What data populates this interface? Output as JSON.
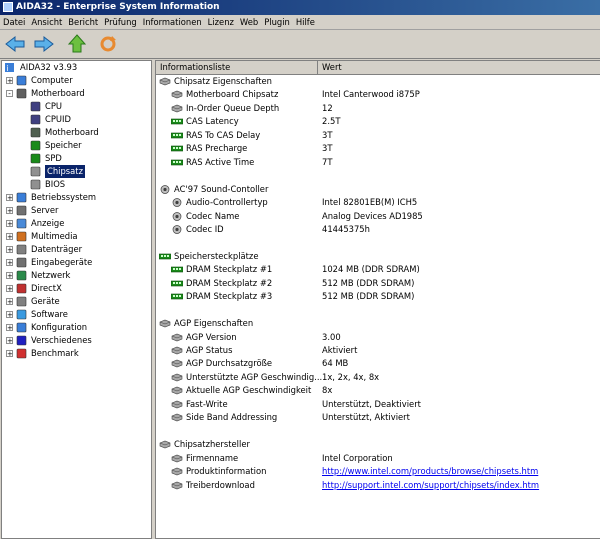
{
  "window": {
    "title": "AIDA32 - Enterprise System Information"
  },
  "menu": [
    "Datei",
    "Ansicht",
    "Bericht",
    "Prüfung",
    "Informationen",
    "Lizenz",
    "Web",
    "Plugin",
    "Hilfe"
  ],
  "toolbar": {
    "buttons": [
      "back-arrow-icon",
      "forward-arrow-icon",
      "up-arrow-icon",
      "refresh-icon"
    ]
  },
  "tree": {
    "root": "AIDA32 v3.93",
    "items": [
      {
        "label": "Computer",
        "level": 1,
        "expander": "+"
      },
      {
        "label": "Motherboard",
        "level": 1,
        "expander": "-"
      },
      {
        "label": "CPU",
        "level": 2
      },
      {
        "label": "CPUID",
        "level": 2
      },
      {
        "label": "Motherboard",
        "level": 2
      },
      {
        "label": "Speicher",
        "level": 2
      },
      {
        "label": "SPD",
        "level": 2
      },
      {
        "label": "Chipsatz",
        "level": 2,
        "selected": true
      },
      {
        "label": "BIOS",
        "level": 2
      },
      {
        "label": "Betriebssystem",
        "level": 1,
        "expander": "+"
      },
      {
        "label": "Server",
        "level": 1,
        "expander": "+"
      },
      {
        "label": "Anzeige",
        "level": 1,
        "expander": "+"
      },
      {
        "label": "Multimedia",
        "level": 1,
        "expander": "+"
      },
      {
        "label": "Datenträger",
        "level": 1,
        "expander": "+"
      },
      {
        "label": "Eingabegeräte",
        "level": 1,
        "expander": "+"
      },
      {
        "label": "Netzwerk",
        "level": 1,
        "expander": "+"
      },
      {
        "label": "DirectX",
        "level": 1,
        "expander": "+"
      },
      {
        "label": "Geräte",
        "level": 1,
        "expander": "+"
      },
      {
        "label": "Software",
        "level": 1,
        "expander": "+"
      },
      {
        "label": "Konfiguration",
        "level": 1,
        "expander": "+"
      },
      {
        "label": "Verschiedenes",
        "level": 1,
        "expander": "+"
      },
      {
        "label": "Benchmark",
        "level": 1,
        "expander": "+"
      }
    ]
  },
  "list": {
    "col_field": "Informationsliste",
    "col_value": "Wert",
    "rows": [
      {
        "type": "group",
        "label": "Chipsatz Eigenschaften"
      },
      {
        "type": "item",
        "label": "Motherboard Chipsatz",
        "value": "Intel Canterwood i875P",
        "icon": "chip"
      },
      {
        "type": "item",
        "label": "In-Order Queue Depth",
        "value": "12",
        "icon": "chip"
      },
      {
        "type": "item",
        "label": "CAS Latency",
        "value": "2.5T",
        "icon": "ram"
      },
      {
        "type": "item",
        "label": "RAS To CAS Delay",
        "value": "3T",
        "icon": "ram"
      },
      {
        "type": "item",
        "label": "RAS Precharge",
        "value": "3T",
        "icon": "ram"
      },
      {
        "type": "item",
        "label": "RAS Active Time",
        "value": "7T",
        "icon": "ram"
      },
      {
        "type": "blank"
      },
      {
        "type": "group",
        "label": "AC'97 Sound-Contoller",
        "icon": "speaker"
      },
      {
        "type": "item",
        "label": "Audio-Controllertyp",
        "value": "Intel 82801EB(M) ICH5",
        "icon": "speaker"
      },
      {
        "type": "item",
        "label": "Codec Name",
        "value": "Analog Devices AD1985",
        "icon": "speaker"
      },
      {
        "type": "item",
        "label": "Codec ID",
        "value": "41445375h",
        "icon": "speaker"
      },
      {
        "type": "blank"
      },
      {
        "type": "group",
        "label": "Speichersteckplätze",
        "icon": "ram"
      },
      {
        "type": "item",
        "label": "DRAM Steckplatz #1",
        "value": "1024 MB (DDR SDRAM)",
        "icon": "ram"
      },
      {
        "type": "item",
        "label": "DRAM Steckplatz #2",
        "value": "512 MB (DDR SDRAM)",
        "icon": "ram"
      },
      {
        "type": "item",
        "label": "DRAM Steckplatz #3",
        "value": "512 MB (DDR SDRAM)",
        "icon": "ram"
      },
      {
        "type": "blank"
      },
      {
        "type": "group",
        "label": "AGP Eigenschaften"
      },
      {
        "type": "item",
        "label": "AGP Version",
        "value": "3.00",
        "icon": "chip"
      },
      {
        "type": "item",
        "label": "AGP Status",
        "value": "Aktiviert",
        "icon": "chip"
      },
      {
        "type": "item",
        "label": "AGP Durchsatzgröße",
        "value": "64 MB",
        "icon": "chip"
      },
      {
        "type": "item",
        "label": "Unterstützte AGP Geschwindig...",
        "value": "1x, 2x, 4x, 8x",
        "icon": "chip"
      },
      {
        "type": "item",
        "label": "Aktuelle AGP Geschwindigkeit",
        "value": "8x",
        "icon": "chip"
      },
      {
        "type": "item",
        "label": "Fast-Write",
        "value": "Unterstützt, Deaktiviert",
        "icon": "chip"
      },
      {
        "type": "item",
        "label": "Side Band Addressing",
        "value": "Unterstützt, Aktiviert",
        "icon": "chip"
      },
      {
        "type": "blank"
      },
      {
        "type": "group",
        "label": "Chipsatzhersteller"
      },
      {
        "type": "item",
        "label": "Firmenname",
        "value": "Intel Corporation",
        "icon": "chip"
      },
      {
        "type": "item",
        "label": "Produktinformation",
        "value": "http://www.intel.com/products/browse/chipsets.htm",
        "icon": "chip",
        "link": true
      },
      {
        "type": "item",
        "label": "Treiberdownload",
        "value": "http://support.intel.com/support/chipsets/index.htm",
        "icon": "chip",
        "link": true
      }
    ]
  },
  "colors": {
    "title_start": "#0a246a",
    "title_end": "#3a6ea5",
    "selection": "#0a246a",
    "link": "#0000ee",
    "ram_green": "#1a8a1a"
  }
}
